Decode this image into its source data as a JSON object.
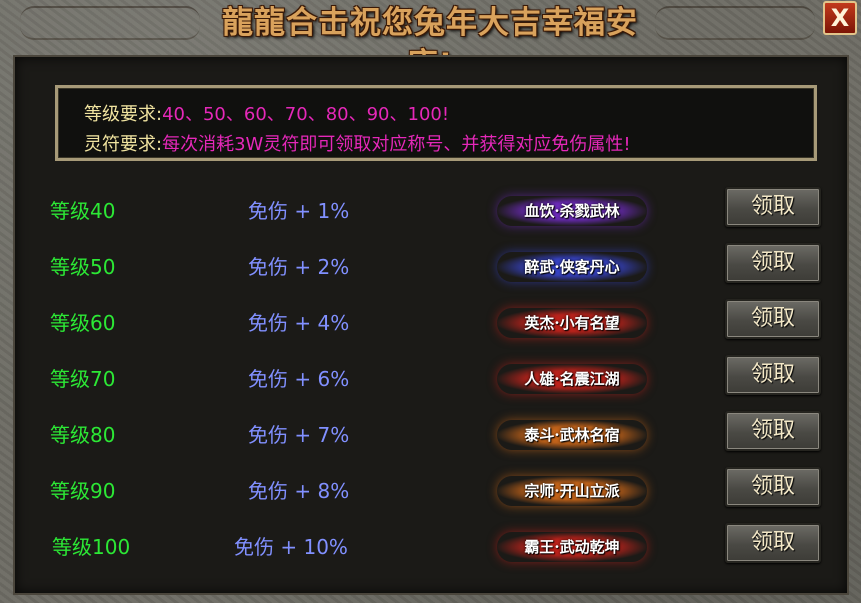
{
  "window": {
    "title": "龍龍合击祝您兔年大吉幸福安康!",
    "close_label": "X"
  },
  "notice": {
    "level_label": "等级要求:",
    "level_value": "40、50、60、70、80、90、100!",
    "rune_label": "灵符要求:",
    "rune_value": "每次消耗3W灵符即可领取对应称号、并获得对应免伤属性!"
  },
  "rewards": [
    {
      "level": "等级40",
      "damage": "免伤 + 1%",
      "title": "血饮·杀戮武林",
      "button": "领取",
      "color": "#7a2ed6"
    },
    {
      "level": "等级50",
      "damage": "免伤 + 2%",
      "title": "醉武·侠客丹心",
      "button": "领取",
      "color": "#3b49e0"
    },
    {
      "level": "等级60",
      "damage": "免伤 + 4%",
      "title": "英杰·小有名望",
      "button": "领取",
      "color": "#d8241c"
    },
    {
      "level": "等级70",
      "damage": "免伤 + 6%",
      "title": "人雄·名震江湖",
      "button": "领取",
      "color": "#d8241c"
    },
    {
      "level": "等级80",
      "damage": "免伤 + 7%",
      "title": "泰斗·武林名宿",
      "button": "领取",
      "color": "#e0701a"
    },
    {
      "level": "等级90",
      "damage": "免伤 + 8%",
      "title": "宗师·开山立派",
      "button": "领取",
      "color": "#e0701a"
    },
    {
      "level": "等级100",
      "damage": "免伤 + 10%",
      "title": "霸王·武动乾坤",
      "button": "领取",
      "color": "#d8241c"
    }
  ]
}
